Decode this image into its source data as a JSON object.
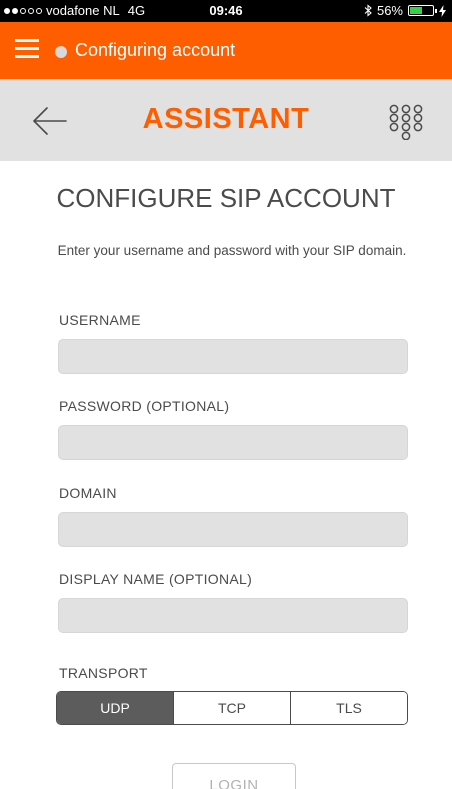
{
  "status_bar": {
    "carrier": "vodafone NL",
    "network": "4G",
    "time": "09:46",
    "battery_percent": "56%",
    "battery_level": 0.56,
    "signal_bars_filled": 2,
    "signal_bars_total": 5
  },
  "top_bar": {
    "status_text": "Configuring account",
    "accent_color": "#ff5e00"
  },
  "header": {
    "title": "ASSISTANT"
  },
  "main": {
    "title": "CONFIGURE SIP ACCOUNT",
    "subtitle": "Enter your username and password with your SIP domain.",
    "fields": {
      "username": {
        "label": "USERNAME",
        "value": ""
      },
      "password": {
        "label": "PASSWORD (OPTIONAL)",
        "value": ""
      },
      "domain": {
        "label": "DOMAIN",
        "value": ""
      },
      "display_name": {
        "label": "DISPLAY NAME (OPTIONAL)",
        "value": ""
      }
    },
    "transport": {
      "label": "TRANSPORT",
      "options": [
        "UDP",
        "TCP",
        "TLS"
      ],
      "selected": "UDP"
    },
    "login_label": "LOGIN"
  }
}
